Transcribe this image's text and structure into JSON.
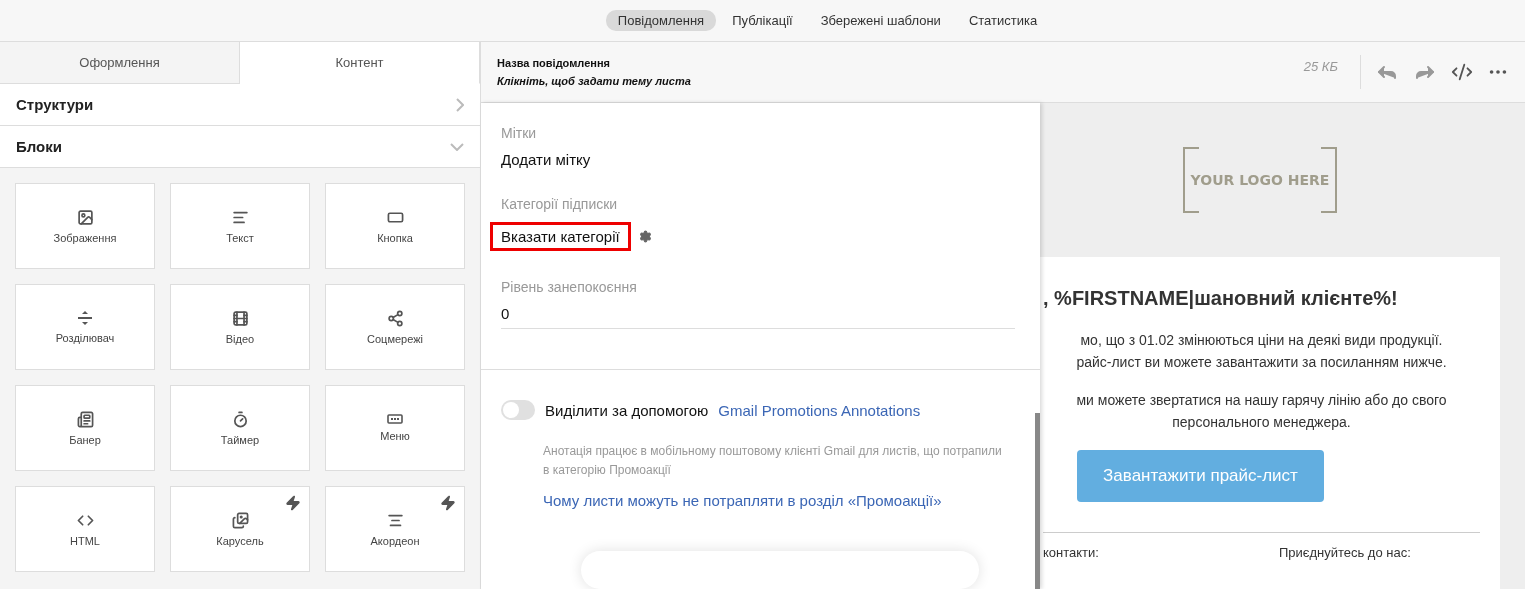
{
  "top_nav": [
    {
      "label": "Повідомлення",
      "selected": true
    },
    {
      "label": "Публікації",
      "selected": false
    },
    {
      "label": "Збережені шаблони",
      "selected": false
    },
    {
      "label": "Статистика",
      "selected": false
    }
  ],
  "sidebar": {
    "tabs": [
      {
        "label": "Оформлення",
        "selected": false
      },
      {
        "label": "Контент",
        "selected": true
      }
    ],
    "sections": [
      {
        "title": "Структури",
        "expanded": false
      },
      {
        "title": "Блоки",
        "expanded": true
      }
    ],
    "blocks": [
      {
        "label": "Зображення",
        "premium": false
      },
      {
        "label": "Текст",
        "premium": false
      },
      {
        "label": "Кнопка",
        "premium": false
      },
      {
        "label": "Розділювач",
        "premium": false
      },
      {
        "label": "Відео",
        "premium": false
      },
      {
        "label": "Соцмережі",
        "premium": false
      },
      {
        "label": "Банер",
        "premium": false
      },
      {
        "label": "Таймер",
        "premium": false
      },
      {
        "label": "Меню",
        "premium": false
      },
      {
        "label": "HTML",
        "premium": false
      },
      {
        "label": "Карусель",
        "premium": true
      },
      {
        "label": "Акордеон",
        "premium": true
      }
    ]
  },
  "header": {
    "title": "Назва повідомлення",
    "subject": "Клікніть, щоб задати тему листа",
    "size": "25 КБ"
  },
  "settings": {
    "fields": [
      {
        "kind": "link",
        "label": "Мітки",
        "value": "Додати мітку"
      },
      {
        "kind": "settings",
        "label": "Категорії підписки",
        "value": "Вказати категорії",
        "highlighted": true
      },
      {
        "kind": "input",
        "label": "Рівень занепокоєння",
        "value": "0"
      }
    ],
    "toggle": {
      "on": false,
      "label": "Виділити за допомогою",
      "link": "Gmail Promotions Annotations",
      "hint": "Анотація працює в мобільному поштовому клієнті Gmail для листів, що потрапили в категорію Промоакції",
      "help_link": "Чому листи можуть не потрапляти в розділ «Промоакції»"
    }
  },
  "preview": {
    "logo": "YOUR LOGO HERE",
    "heading": ", %FIRSTNAME|шановний клієнте%!",
    "paragraphs": [
      [
        "мо, що з 01.02 змінюються ціни на деякі види продукції.",
        "райс-лист ви можете завантажити за посиланням нижче."
      ],
      [
        "ми можете звертатися на нашу гарячу лінію або до свого",
        "персонального менеджера."
      ]
    ],
    "button": "Завантажити прайс-лист",
    "footer": [
      "контакти:",
      "Приєднуйтесь до нас:"
    ]
  }
}
